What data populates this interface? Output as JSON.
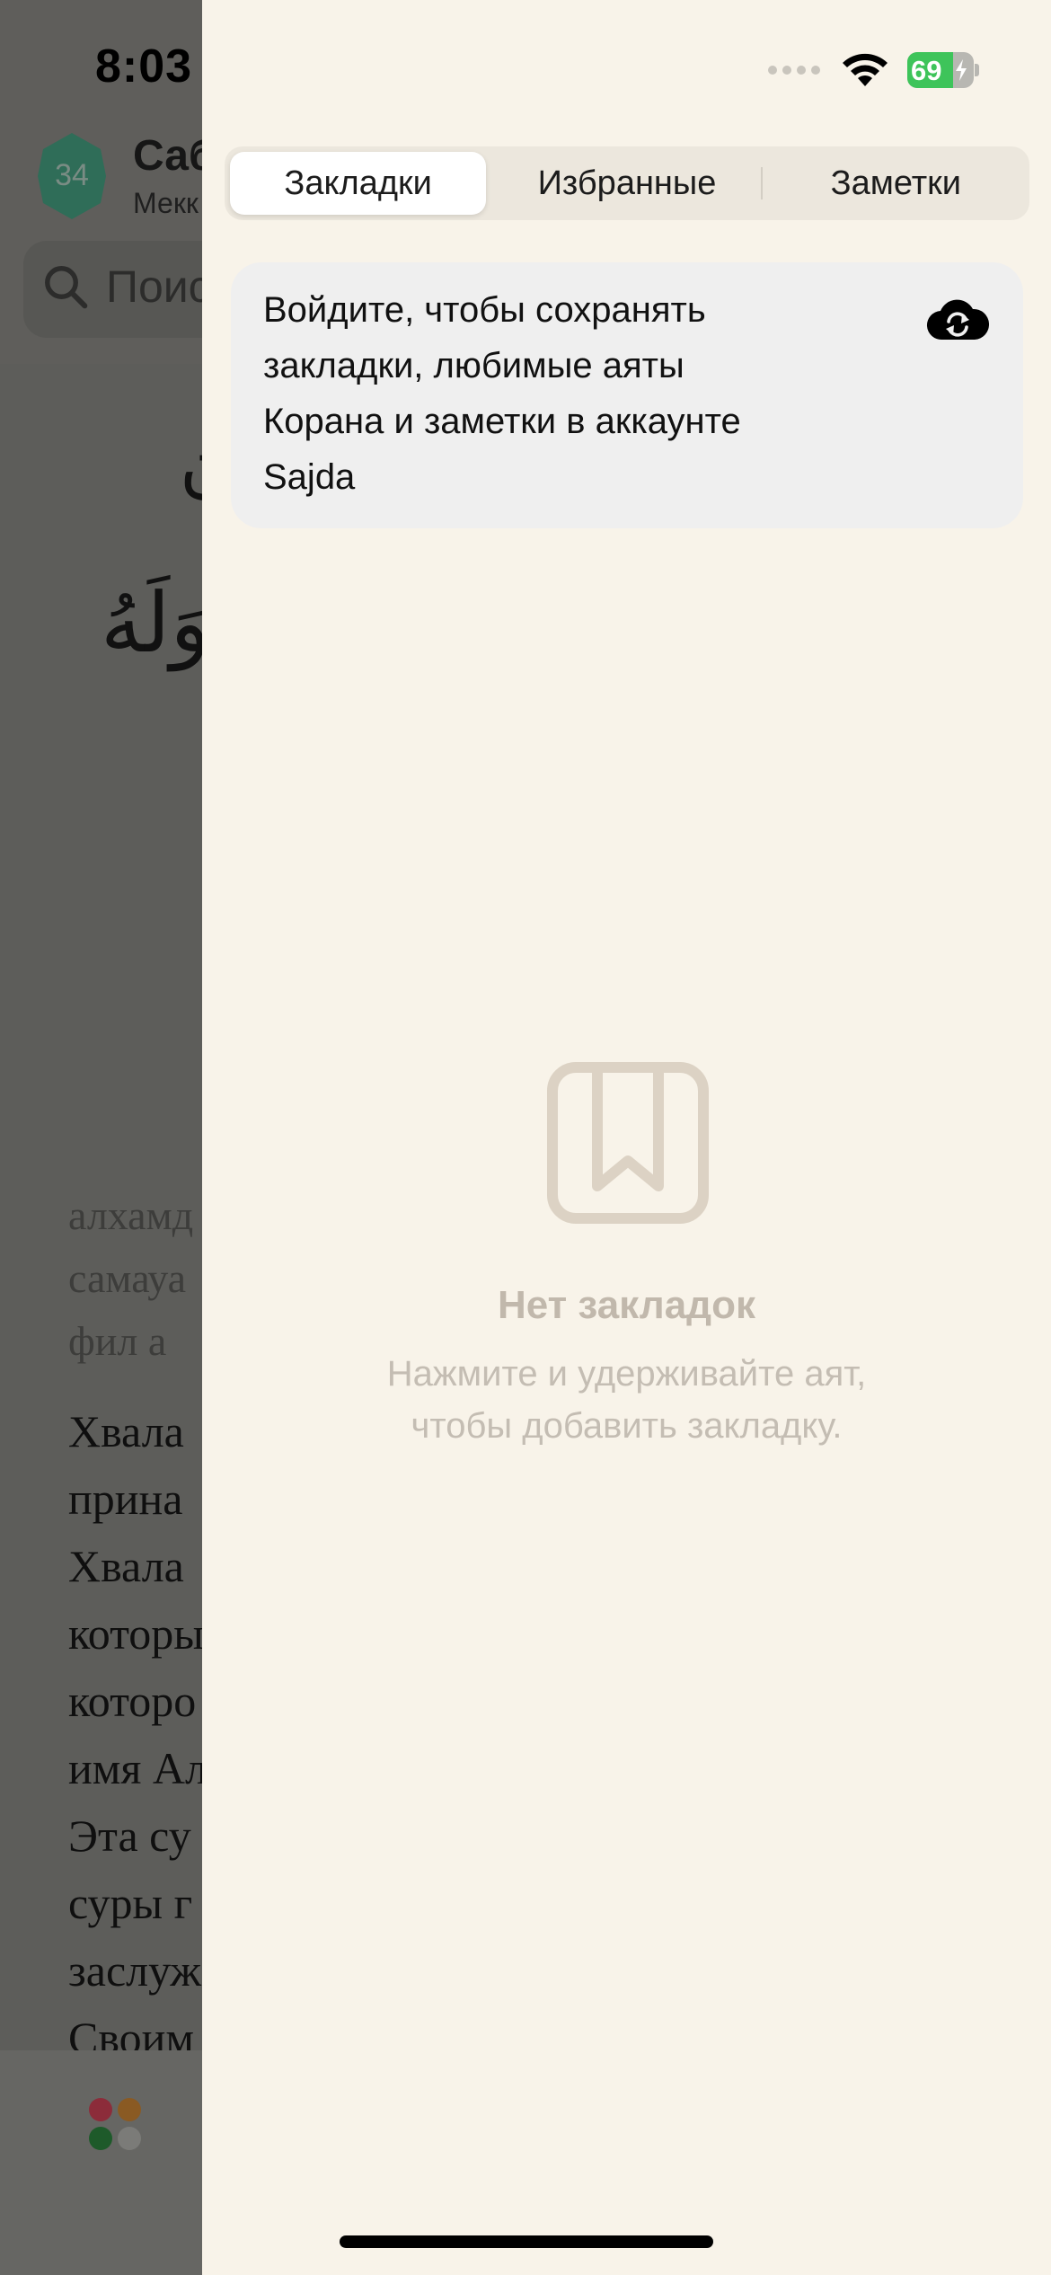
{
  "status_bar": {
    "time": "8:03",
    "battery": {
      "level_text": "69",
      "level_percent": 69,
      "fill_color": "#3ec45a"
    },
    "icons": [
      "location-arrow-icon",
      "cellular-icon",
      "wifi-icon",
      "battery-icon",
      "charging-bolt-icon"
    ]
  },
  "background_app": {
    "surah_number": "34",
    "surah_name": "Саб",
    "surah_subtitle": "Мекк",
    "search_placeholder": "Поис",
    "arabic_line_1": "ن",
    "arabic_line_2": "وَلَهُ",
    "transliteration": [
      "алхамд",
      "самауа",
      "фил а"
    ],
    "translation": [
      "Хвала",
      "прина",
      "Хвала",
      "которы",
      "которо",
      "имя Ал",
      "Эта су",
      "суры г",
      "заслуж",
      "Своим"
    ],
    "badge_color": "#2f6d58"
  },
  "panel": {
    "tabs": [
      {
        "label": "Закладки",
        "active": true
      },
      {
        "label": "Избранные",
        "active": false
      },
      {
        "label": "Заметки",
        "active": false
      }
    ],
    "signin_card": {
      "lines": [
        "Войдите, чтобы сохранять",
        "закладки, любимые аяты",
        "Корана и заметки в аккаунте",
        "Sajda"
      ],
      "icon": "cloud-sync-icon"
    },
    "empty_state": {
      "icon": "bookmark-icon",
      "title": "Нет закладок",
      "subtitle_lines": [
        "Нажмите и удерживайте аят,",
        "чтобы добавить закладку."
      ]
    },
    "colors": {
      "panel_bg": "#f8f3e9",
      "empty_icon": "#dcd2c4"
    }
  }
}
